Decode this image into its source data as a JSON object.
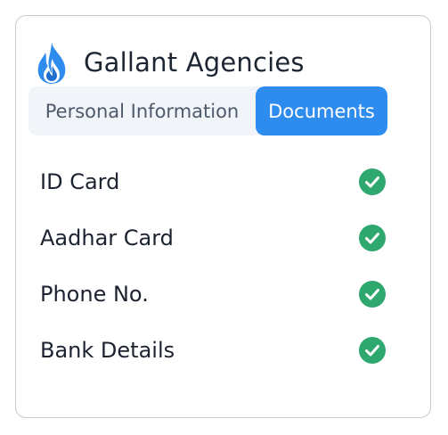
{
  "header": {
    "brand_name": "Gallant Agencies",
    "logo_icon": "flame-icon"
  },
  "tabs": [
    {
      "label": "Personal Information",
      "active": false
    },
    {
      "label": "Documents",
      "active": true
    }
  ],
  "documents": [
    {
      "label": "ID Card",
      "status": "verified",
      "icon": "check-circle-icon"
    },
    {
      "label": "Aadhar Card",
      "status": "verified",
      "icon": "check-circle-icon"
    },
    {
      "label": "Phone No.",
      "status": "verified",
      "icon": "check-circle-icon"
    },
    {
      "label": "Bank Details",
      "status": "verified",
      "icon": "check-circle-icon"
    }
  ],
  "colors": {
    "accent": "#2f8cef",
    "check": "#2ea86e",
    "border": "#c5cad3",
    "tab_bg": "#f1f4f8"
  }
}
